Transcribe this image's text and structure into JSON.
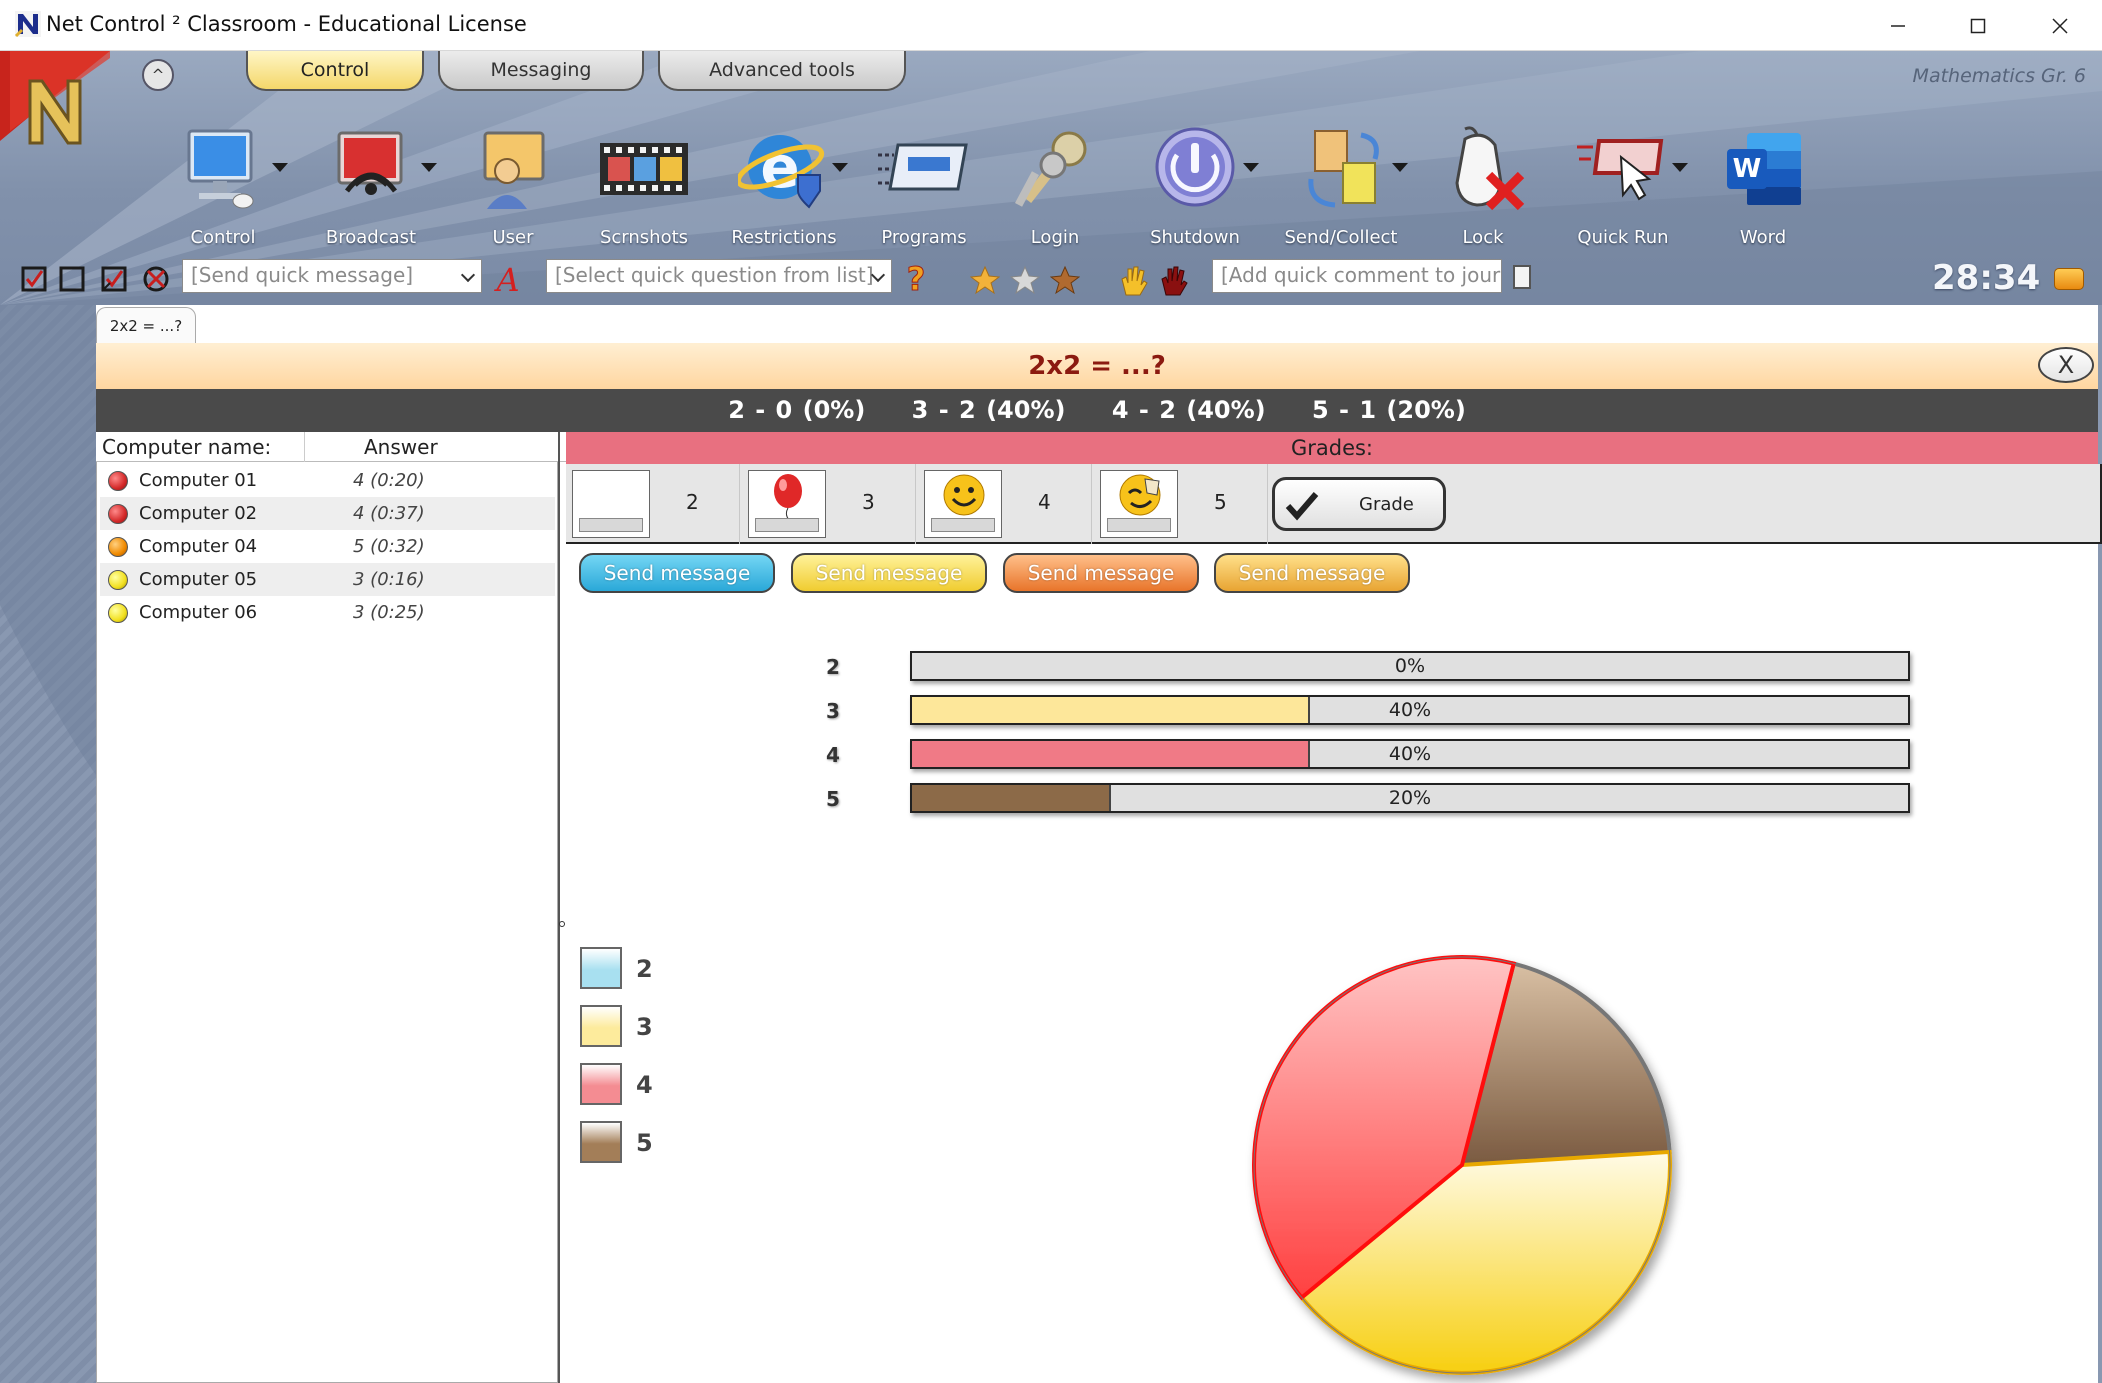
{
  "window": {
    "title": "Net Control ² Classroom - Educational License"
  },
  "ribbon": {
    "tabs": [
      {
        "label": "Control",
        "active": true
      },
      {
        "label": "Messaging",
        "active": false
      },
      {
        "label": "Advanced tools",
        "active": false
      }
    ],
    "collapse_label": "^",
    "class_name": "Mathematics Gr. 6",
    "tools": [
      {
        "label": "Control",
        "icon": "monitor-icon",
        "dropdown": true
      },
      {
        "label": "Broadcast",
        "icon": "broadcast-icon",
        "dropdown": true
      },
      {
        "label": "User",
        "icon": "user-icon",
        "dropdown": false
      },
      {
        "label": "Scrnshots",
        "icon": "screenshots-icon",
        "dropdown": false
      },
      {
        "label": "Restrictions",
        "icon": "internet-explorer-icon",
        "dropdown": true
      },
      {
        "label": "Programs",
        "icon": "programs-icon",
        "dropdown": false
      },
      {
        "label": "Login",
        "icon": "keys-icon",
        "dropdown": false
      },
      {
        "label": "Shutdown",
        "icon": "power-icon",
        "dropdown": true
      },
      {
        "label": "Send/Collect",
        "icon": "send-collect-icon",
        "dropdown": true
      },
      {
        "label": "Lock",
        "icon": "lock-mouse-icon",
        "dropdown": false
      },
      {
        "label": "Quick Run",
        "icon": "quick-run-icon",
        "dropdown": true
      },
      {
        "label": "Word",
        "icon": "word-icon",
        "dropdown": false
      }
    ]
  },
  "quickbar": {
    "message_placeholder": "[Send quick message]",
    "question_placeholder": "[Select quick question from list]",
    "comment_placeholder": "[Add quick comment to journal]",
    "timer": "28:34"
  },
  "question": {
    "tab_label": "2x2 = ...?",
    "title": "2x2 = ...?",
    "close_label": "X",
    "summary": [
      "2 - 0 (0%)",
      "3 - 2 (40%)",
      "4 - 2 (40%)",
      "5 - 1 (20%)"
    ]
  },
  "list": {
    "col_name": "Computer name:",
    "col_answer": "Answer",
    "rows": [
      {
        "name": "Computer 01",
        "answer": "4 (0:20)",
        "status_color": "#d42a2a"
      },
      {
        "name": "Computer 02",
        "answer": "4 (0:37)",
        "status_color": "#d42a2a"
      },
      {
        "name": "Computer 04",
        "answer": "5 (0:32)",
        "status_color": "#f08a00"
      },
      {
        "name": "Computer 05",
        "answer": "3 (0:16)",
        "status_color": "#f2e020"
      },
      {
        "name": "Computer 06",
        "answer": "3 (0:25)",
        "status_color": "#f2e020"
      }
    ]
  },
  "grades": {
    "header": "Grades:",
    "cells": [
      {
        "value": "2",
        "icon": "blank-icon"
      },
      {
        "value": "3",
        "icon": "balloon-icon"
      },
      {
        "value": "4",
        "icon": "smiley-icon"
      },
      {
        "value": "5",
        "icon": "thumbs-up-smiley-icon"
      }
    ],
    "grade_button": "Grade",
    "send_buttons": [
      {
        "label": "Send message",
        "color": "#39b6df"
      },
      {
        "label": "Send message",
        "color": "#f2d43a"
      },
      {
        "label": "Send message",
        "color": "#ef8a3a"
      },
      {
        "label": "Send message",
        "color": "#f1b63f"
      }
    ]
  },
  "results": {
    "bars": [
      {
        "label": "2",
        "percent": 0,
        "text": "0%",
        "color": "#9fdcef"
      },
      {
        "label": "3",
        "percent": 40,
        "text": "40%",
        "color": "#fde79a"
      },
      {
        "label": "4",
        "percent": 40,
        "text": "40%",
        "color": "#f07a86"
      },
      {
        "label": "5",
        "percent": 20,
        "text": "20%",
        "color": "#8c6a48"
      }
    ],
    "legend": [
      {
        "label": "2",
        "color": "#a8e0f0"
      },
      {
        "label": "3",
        "color": "#fdeb9c"
      },
      {
        "label": "4",
        "color": "#f48c92"
      },
      {
        "label": "5",
        "color": "#a37e58"
      }
    ]
  },
  "chart_data": {
    "type": "pie",
    "categories": [
      "2",
      "3",
      "4",
      "5"
    ],
    "values": [
      0,
      40,
      40,
      20
    ],
    "colors": [
      "#a8e0f0",
      "#fde79a",
      "#ff6b6b",
      "#9a7a5a"
    ]
  }
}
